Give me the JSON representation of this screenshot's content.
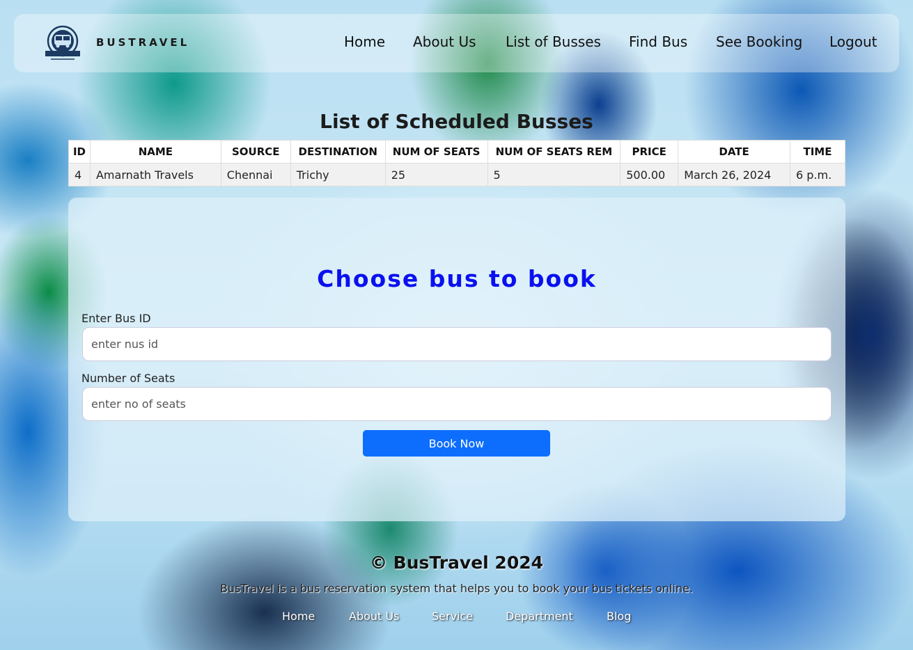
{
  "navbar": {
    "brand": "BUSTRAVEL",
    "logo_text": "BUSTRAVEL",
    "links": [
      "Home",
      "About Us",
      "List of Busses",
      "Find Bus",
      "See Booking",
      "Logout"
    ]
  },
  "page_title": "List of Scheduled Busses",
  "table": {
    "headers": [
      "ID",
      "NAME",
      "SOURCE",
      "DESTINATION",
      "NUM OF SEATS",
      "NUM OF SEATS REM",
      "PRICE",
      "DATE",
      "TIME"
    ],
    "rows": [
      [
        "4",
        "Amarnath Travels",
        "Chennai",
        "Trichy",
        "25",
        "5",
        "500.00",
        "March 26, 2024",
        "6 p.m."
      ]
    ]
  },
  "form": {
    "title": "Choose bus to book",
    "bus_id_label": "Enter Bus ID",
    "bus_id_placeholder": "enter nus id",
    "seats_label": "Number of Seats",
    "seats_placeholder": "enter no of seats",
    "submit_label": "Book Now"
  },
  "footer": {
    "copyright": "© BusTravel 2024",
    "description": "BusTravel is a bus reservation system that helps you to book your bus tickets online.",
    "links": [
      "Home",
      "About Us",
      "Service",
      "Department",
      "Blog"
    ]
  },
  "colors": {
    "accent": "#0d6efd",
    "form_title": "#0a10f0"
  }
}
